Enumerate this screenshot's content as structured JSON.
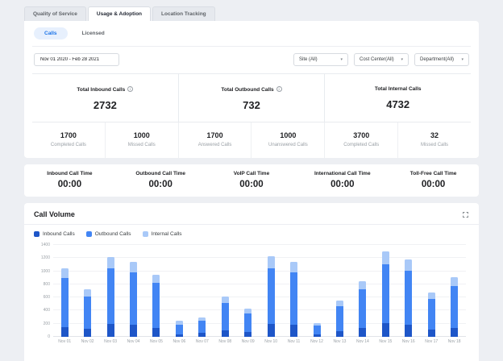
{
  "tabs": [
    {
      "label": "Quality of Service",
      "active": false
    },
    {
      "label": "Usage & Adoption",
      "active": true
    },
    {
      "label": "Location Tracking",
      "active": false
    }
  ],
  "view_toggle": {
    "calls": "Calls",
    "licensed": "Licensed"
  },
  "filters": {
    "date_range": "Nov 01 2020 - Feb 28 2021",
    "site": "Site (All)",
    "cost_center": "Cost Center(All)",
    "department": "Department(All)"
  },
  "totals": [
    {
      "label": "Total Inbound Calls",
      "value": "2732"
    },
    {
      "label": "Total Outbound Calls",
      "value": "732"
    },
    {
      "label": "Total Internal Calls",
      "value": "4732"
    }
  ],
  "substats": [
    {
      "value": "1700",
      "label": "Completed Calls"
    },
    {
      "value": "1000",
      "label": "Missed Calls"
    },
    {
      "value": "1700",
      "label": "Answered Calls"
    },
    {
      "value": "1000",
      "label": "Unanswered Calls"
    },
    {
      "value": "3700",
      "label": "Completed Calls"
    },
    {
      "value": "32",
      "label": "Missed Calls"
    }
  ],
  "call_times": [
    {
      "label": "Inbound Call Time",
      "value": "00:00"
    },
    {
      "label": "Outbound Call Time",
      "value": "00:00"
    },
    {
      "label": "VoIP Call Time",
      "value": "00:00"
    },
    {
      "label": "International Call Time",
      "value": "00:00"
    },
    {
      "label": "Toll-Free Call Time",
      "value": "00:00"
    }
  ],
  "chart": {
    "title": "Call Volume"
  },
  "chart_data": {
    "type": "bar",
    "stacked": true,
    "title": "Call Volume",
    "xlabel": "",
    "ylabel": "",
    "ylim": [
      0,
      1400
    ],
    "yticks": [
      0,
      200,
      400,
      600,
      800,
      1000,
      1200,
      1400
    ],
    "grid": true,
    "legend_position": "top-left",
    "categories": [
      "Nov 01",
      "Nov 02",
      "Nov 03",
      "Nov 04",
      "Nov 05",
      "Nov 06",
      "Nov 07",
      "Nov 08",
      "Nov 09",
      "Nov 10",
      "Nov 11",
      "Nov 12",
      "Nov 13",
      "Nov 14",
      "Nov 15",
      "Nov 16",
      "Nov 17",
      "Nov 18"
    ],
    "series": [
      {
        "name": "Inbound Calls",
        "color": "#1e56c8",
        "values": [
          150,
          120,
          200,
          180,
          140,
          40,
          60,
          100,
          80,
          200,
          180,
          40,
          90,
          130,
          210,
          190,
          110,
          140
        ]
      },
      {
        "name": "Outbound Calls",
        "color": "#4285f4",
        "values": [
          750,
          500,
          850,
          800,
          680,
          150,
          180,
          420,
          280,
          850,
          800,
          130,
          380,
          600,
          900,
          820,
          470,
          640
        ]
      },
      {
        "name": "Internal Calls",
        "color": "#a9c9f8",
        "values": [
          150,
          110,
          170,
          160,
          130,
          50,
          60,
          90,
          70,
          180,
          160,
          40,
          80,
          120,
          190,
          170,
          90,
          130
        ]
      }
    ]
  },
  "colors": {
    "accent": "#1a73e8",
    "pill_bg": "#e7f0fd",
    "card_bg": "#ffffff",
    "page_bg": "#edeff3"
  }
}
